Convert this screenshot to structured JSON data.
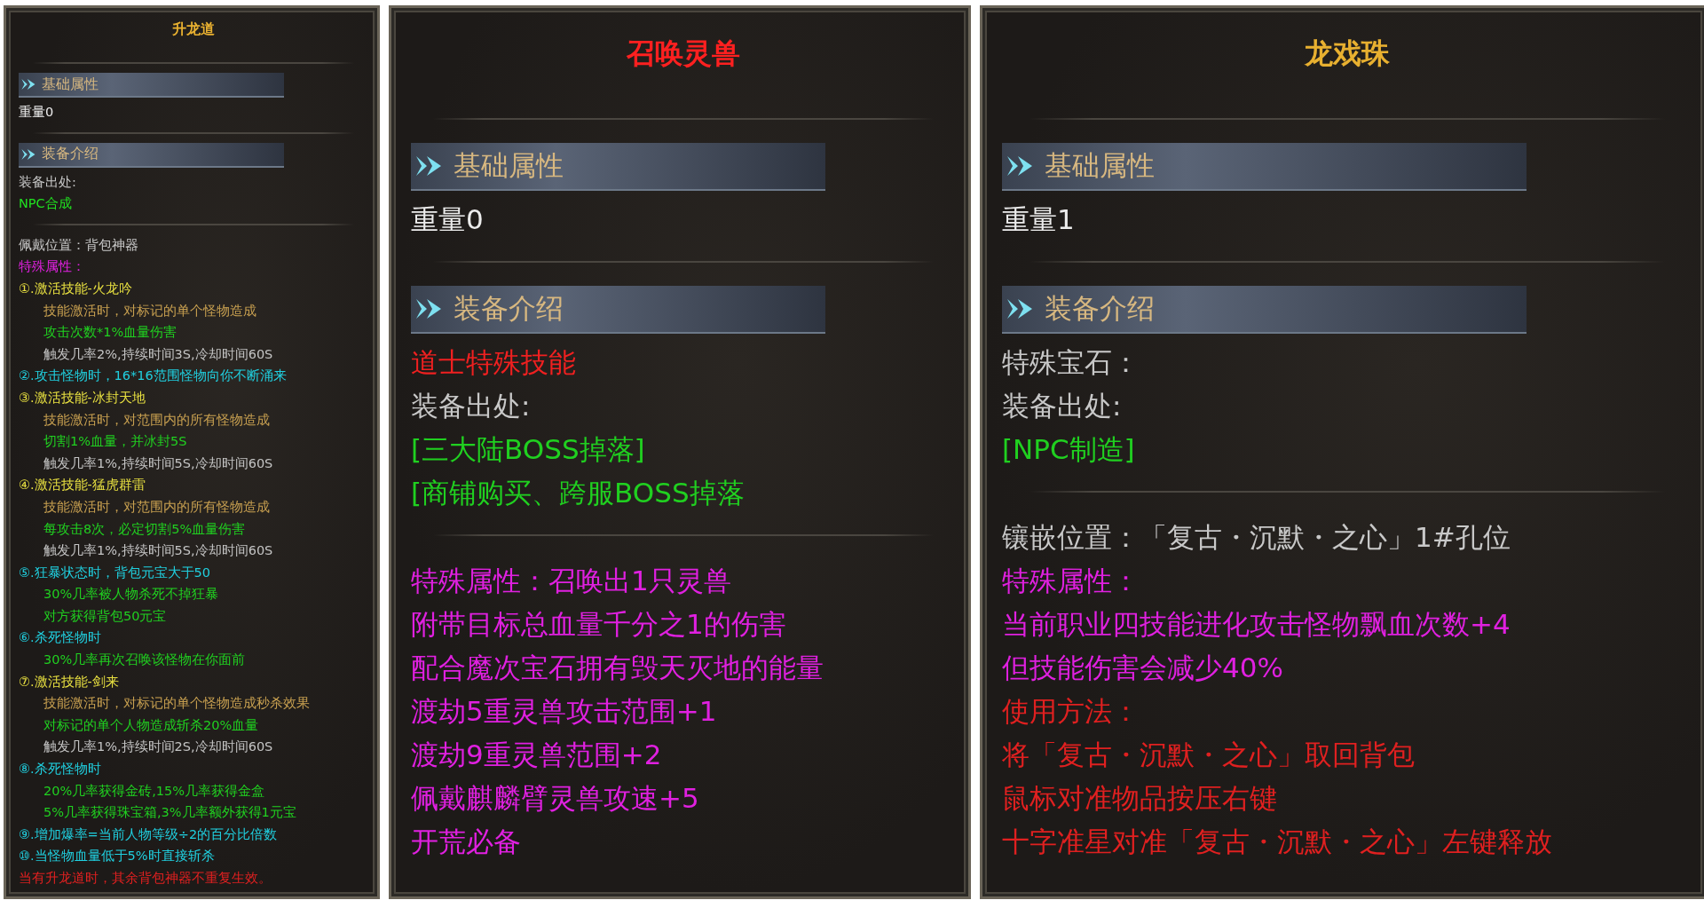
{
  "panels": [
    {
      "title": "升龙道",
      "color": "#e8b030",
      "blocks": [
        {
          "kind": "divider"
        },
        {
          "kind": "header",
          "text": "基础属性"
        },
        {
          "kind": "line",
          "text": "重量0",
          "color": "#ececec"
        },
        {
          "kind": "divider"
        },
        {
          "kind": "header",
          "text": "装备介绍"
        },
        {
          "kind": "line",
          "text": "装备出处:",
          "color": "#c8c8c8"
        },
        {
          "kind": "line",
          "text": "NPC合成",
          "color": "#20e020"
        },
        {
          "kind": "divider"
        },
        {
          "kind": "line",
          "text": "佩戴位置：背包神器",
          "color": "#c8c8c8"
        },
        {
          "kind": "line",
          "text": "特殊属性：",
          "color": "#e020e0"
        },
        {
          "kind": "line",
          "text": "①.激活技能-火龙吟",
          "color": "#e8e040",
          "children": [
            {
              "text": "技能激活时，对标记的单个怪物造成",
              "color": "#c8a050"
            },
            {
              "text": "攻击次数*1%血量伤害",
              "color": "#20d020"
            },
            {
              "text": "触发几率2%,持续时间3S,冷却时间60S",
              "color": "#c4c4c4"
            }
          ]
        },
        {
          "kind": "line",
          "text": "②.攻击怪物时，16*16范围怪物向你不断涌来",
          "color": "#20d0e0"
        },
        {
          "kind": "line",
          "text": "③.激活技能-冰封天地",
          "color": "#e8e040",
          "children": [
            {
              "text": "技能激活时，对范围内的所有怪物造成",
              "color": "#c8a050"
            },
            {
              "text": "切割1%血量，并冰封5S",
              "color": "#20d020"
            },
            {
              "text": "触发几率1%,持续时间5S,冷却时间60S",
              "color": "#c4c4c4"
            }
          ]
        },
        {
          "kind": "line",
          "text": "④.激活技能-猛虎群雷",
          "color": "#e8e040",
          "children": [
            {
              "text": "技能激活时，对范围内的所有怪物造成",
              "color": "#c8a050"
            },
            {
              "text": "每攻击8次，必定切割5%血量伤害",
              "color": "#20d020"
            },
            {
              "text": "触发几率1%,持续时间5S,冷却时间60S",
              "color": "#c4c4c4"
            }
          ]
        },
        {
          "kind": "line",
          "text": "⑤.狂暴状态时，背包元宝大于50",
          "color": "#20d0e0",
          "children": [
            {
              "text": "30%几率被人物杀死不掉狂暴",
              "color": "#20d020"
            },
            {
              "text": "对方获得背包50元宝",
              "color": "#20d020"
            }
          ]
        },
        {
          "kind": "line",
          "text": "⑥.杀死怪物时",
          "color": "#20d0e0",
          "children": [
            {
              "text": "30%几率再次召唤该怪物在你面前",
              "color": "#20d020"
            }
          ]
        },
        {
          "kind": "line",
          "text": "⑦.激活技能-剑来",
          "color": "#e8e040",
          "children": [
            {
              "text": "技能激活时，对标记的单个怪物造成秒杀效果",
              "color": "#c8a050"
            },
            {
              "text": "对标记的单个人物造成斩杀20%血量",
              "color": "#20d020"
            },
            {
              "text": "触发几率1%,持续时间2S,冷却时间60S",
              "color": "#c4c4c4"
            }
          ]
        },
        {
          "kind": "line",
          "text": "⑧.杀死怪物时",
          "color": "#20d0e0",
          "children": [
            {
              "text": "20%几率获得金砖,15%几率获得金盒",
              "color": "#20d020"
            },
            {
              "text": "5%几率获得珠宝箱,3%几率额外获得1元宝",
              "color": "#20d020"
            }
          ]
        },
        {
          "kind": "line",
          "text": "⑨.增加爆率=当前人物等级÷2的百分比倍数",
          "color": "#20d0e0"
        },
        {
          "kind": "line",
          "text": "⑩.当怪物血量低于5%时直接斩杀",
          "color": "#20d0e0"
        },
        {
          "kind": "line",
          "text": "当有升龙道时，其余背包神器不重复生效。",
          "color": "#e02020"
        }
      ]
    },
    {
      "title": "召唤灵兽",
      "color": "#ff2020",
      "blocks": [
        {
          "kind": "divider"
        },
        {
          "kind": "header",
          "text": "基础属性"
        },
        {
          "kind": "line",
          "text": "重量0",
          "color": "#ececec"
        },
        {
          "kind": "divider"
        },
        {
          "kind": "header",
          "text": "装备介绍"
        },
        {
          "kind": "line",
          "text": "道士特殊技能",
          "color": "#f02020"
        },
        {
          "kind": "line",
          "text": "装备出处:",
          "color": "#c8c8c8"
        },
        {
          "kind": "line",
          "text": "[三大陆BOSS掉落]",
          "color": "#20d020"
        },
        {
          "kind": "line",
          "text": "[商铺购买、跨服BOSS掉落",
          "color": "#20d020"
        },
        {
          "kind": "divider"
        },
        {
          "kind": "line",
          "text": "特殊属性：召唤出1只灵兽",
          "color": "#e020e0"
        },
        {
          "kind": "line",
          "text": "附带目标总血量千分之1的伤害",
          "color": "#e020e0"
        },
        {
          "kind": "line",
          "text": "配合魔次宝石拥有毁天灭地的能量",
          "color": "#e020e0"
        },
        {
          "kind": "line",
          "text": "渡劫5重灵兽攻击范围+1",
          "color": "#e020e0"
        },
        {
          "kind": "line",
          "text": "渡劫9重灵兽范围+2",
          "color": "#e020e0"
        },
        {
          "kind": "line",
          "text": "佩戴麒麟臂灵兽攻速+5",
          "color": "#e020e0"
        },
        {
          "kind": "line",
          "text": "开荒必备",
          "color": "#e020e0"
        }
      ]
    },
    {
      "title": "龙戏珠",
      "color": "#e8b030",
      "blocks": [
        {
          "kind": "divider"
        },
        {
          "kind": "header",
          "text": "基础属性"
        },
        {
          "kind": "line",
          "text": "重量1",
          "color": "#ececec"
        },
        {
          "kind": "divider"
        },
        {
          "kind": "header",
          "text": "装备介绍"
        },
        {
          "kind": "line",
          "text": "特殊宝石：",
          "color": "#c8c8c8"
        },
        {
          "kind": "line",
          "text": "装备出处:",
          "color": "#c8c8c8"
        },
        {
          "kind": "line",
          "text": "[NPC制造]",
          "color": "#20d020"
        },
        {
          "kind": "divider"
        },
        {
          "kind": "line",
          "text": "镶嵌位置：「复古・沉默・之心」1#孔位",
          "color": "#c8c8c8"
        },
        {
          "kind": "line",
          "text": "特殊属性：",
          "color": "#e020e0"
        },
        {
          "kind": "line",
          "text": "当前职业四技能进化攻击怪物飘血次数+4",
          "color": "#e020e0"
        },
        {
          "kind": "line",
          "text": "但技能伤害会减少40%",
          "color": "#e020e0"
        },
        {
          "kind": "line",
          "text": "使用方法：",
          "color": "#e02020"
        },
        {
          "kind": "line",
          "text": "将「复古・沉默・之心」取回背包",
          "color": "#e02020"
        },
        {
          "kind": "line",
          "text": "鼠标对准物品按压右键",
          "color": "#e02020"
        },
        {
          "kind": "line",
          "text": "十字准星对准「复古・沉默・之心」左键释放",
          "color": "#e02020"
        }
      ]
    }
  ]
}
